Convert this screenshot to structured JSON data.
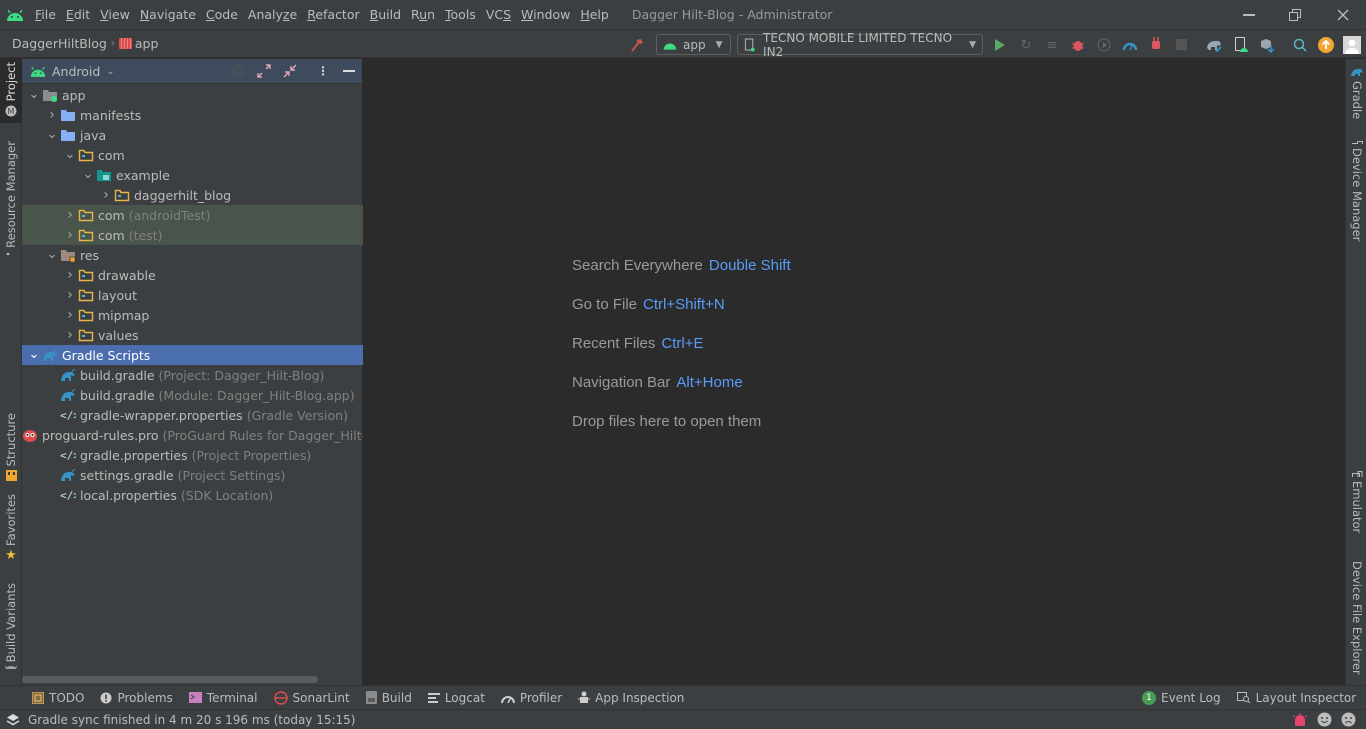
{
  "window": {
    "title": "Dagger Hilt-Blog - Administrator",
    "menu": [
      {
        "label": "File",
        "mnemonic": "F"
      },
      {
        "label": "Edit",
        "mnemonic": "E"
      },
      {
        "label": "View",
        "mnemonic": "V"
      },
      {
        "label": "Navigate",
        "mnemonic": "N"
      },
      {
        "label": "Code",
        "mnemonic": "C"
      },
      {
        "label": "Analyze",
        "mnemonic": "z"
      },
      {
        "label": "Refactor",
        "mnemonic": "R"
      },
      {
        "label": "Build",
        "mnemonic": "B"
      },
      {
        "label": "Run",
        "mnemonic": "u"
      },
      {
        "label": "Tools",
        "mnemonic": "T"
      },
      {
        "label": "VCS",
        "mnemonic": "S"
      },
      {
        "label": "Window",
        "mnemonic": "W"
      },
      {
        "label": "Help",
        "mnemonic": "H"
      }
    ]
  },
  "navbar": {
    "breadcrumb": [
      "DaggerHiltBlog",
      "app"
    ],
    "run_config": "app",
    "device": "TECNO MOBILE LIMITED TECNO IN2"
  },
  "left_tabs": [
    "Project",
    "Resource Manager",
    "Structure",
    "Favorites",
    "Build Variants"
  ],
  "right_tabs": [
    "Gradle",
    "Device Manager",
    "Emulator",
    "Device File Explorer"
  ],
  "project_panel": {
    "view_mode": "Android",
    "tree": [
      {
        "label": "app",
        "hint": "",
        "depth": 0,
        "expanded": true,
        "icon": "module"
      },
      {
        "label": "manifests",
        "hint": "",
        "depth": 1,
        "expanded": false,
        "icon": "folder-blue"
      },
      {
        "label": "java",
        "hint": "",
        "depth": 1,
        "expanded": true,
        "icon": "folder-blue"
      },
      {
        "label": "com",
        "hint": "",
        "depth": 2,
        "expanded": true,
        "icon": "package"
      },
      {
        "label": "example",
        "hint": "",
        "depth": 3,
        "expanded": true,
        "icon": "package-teal"
      },
      {
        "label": "daggerhilt_blog",
        "hint": "",
        "depth": 4,
        "expanded": false,
        "icon": "package"
      },
      {
        "label": "com",
        "hint": "(androidTest)",
        "depth": 2,
        "expanded": false,
        "icon": "package",
        "test": true
      },
      {
        "label": "com",
        "hint": "(test)",
        "depth": 2,
        "expanded": false,
        "icon": "package",
        "test": true
      },
      {
        "label": "res",
        "hint": "",
        "depth": 1,
        "expanded": true,
        "icon": "res"
      },
      {
        "label": "drawable",
        "hint": "",
        "depth": 2,
        "expanded": false,
        "icon": "package"
      },
      {
        "label": "layout",
        "hint": "",
        "depth": 2,
        "expanded": false,
        "icon": "package"
      },
      {
        "label": "mipmap",
        "hint": "",
        "depth": 2,
        "expanded": false,
        "icon": "package"
      },
      {
        "label": "values",
        "hint": "",
        "depth": 2,
        "expanded": false,
        "icon": "package"
      },
      {
        "label": "Gradle Scripts",
        "hint": "",
        "depth": 0,
        "expanded": true,
        "icon": "gradle",
        "selected": true
      },
      {
        "label": "build.gradle",
        "hint": "(Project: Dagger_Hilt-Blog)",
        "depth": 1,
        "icon": "gradle"
      },
      {
        "label": "build.gradle",
        "hint": "(Module: Dagger_Hilt-Blog.app)",
        "depth": 1,
        "icon": "gradle"
      },
      {
        "label": "gradle-wrapper.properties",
        "hint": "(Gradle Version)",
        "depth": 1,
        "icon": "properties"
      },
      {
        "label": "proguard-rules.pro",
        "hint": "(ProGuard Rules for Dagger_Hilt-Blog.app)",
        "depth": 1,
        "icon": "proguard"
      },
      {
        "label": "gradle.properties",
        "hint": "(Project Properties)",
        "depth": 1,
        "icon": "properties"
      },
      {
        "label": "settings.gradle",
        "hint": "(Project Settings)",
        "depth": 1,
        "icon": "gradle"
      },
      {
        "label": "local.properties",
        "hint": "(SDK Location)",
        "depth": 1,
        "icon": "properties"
      }
    ]
  },
  "editor_hints": [
    {
      "label": "Search Everywhere",
      "key": "Double Shift"
    },
    {
      "label": "Go to File",
      "key": "Ctrl+Shift+N"
    },
    {
      "label": "Recent Files",
      "key": "Ctrl+E"
    },
    {
      "label": "Navigation Bar",
      "key": "Alt+Home"
    },
    {
      "label": "Drop files here to open them",
      "key": ""
    }
  ],
  "bottom_tabs": [
    {
      "label": "TODO",
      "icon": "todo-icon"
    },
    {
      "label": "Problems",
      "icon": "problems-icon"
    },
    {
      "label": "Terminal",
      "icon": "terminal-icon"
    },
    {
      "label": "SonarLint",
      "icon": "sonarlint-icon"
    },
    {
      "label": "Build",
      "icon": "build-icon"
    },
    {
      "label": "Logcat",
      "icon": "logcat-icon"
    },
    {
      "label": "Profiler",
      "icon": "profiler-icon"
    },
    {
      "label": "App Inspection",
      "icon": "app-inspection-icon"
    }
  ],
  "bottom_right_tabs": [
    {
      "label": "Event Log",
      "badge": "1"
    },
    {
      "label": "Layout Inspector"
    }
  ],
  "status": {
    "message": "Gradle sync finished in 4 m 20 s 196 ms (today 15:15)"
  },
  "colors": {
    "accent": "#4b6eaf",
    "link": "#589df6",
    "android_green": "#3ddc84",
    "run_green": "#59a869"
  }
}
